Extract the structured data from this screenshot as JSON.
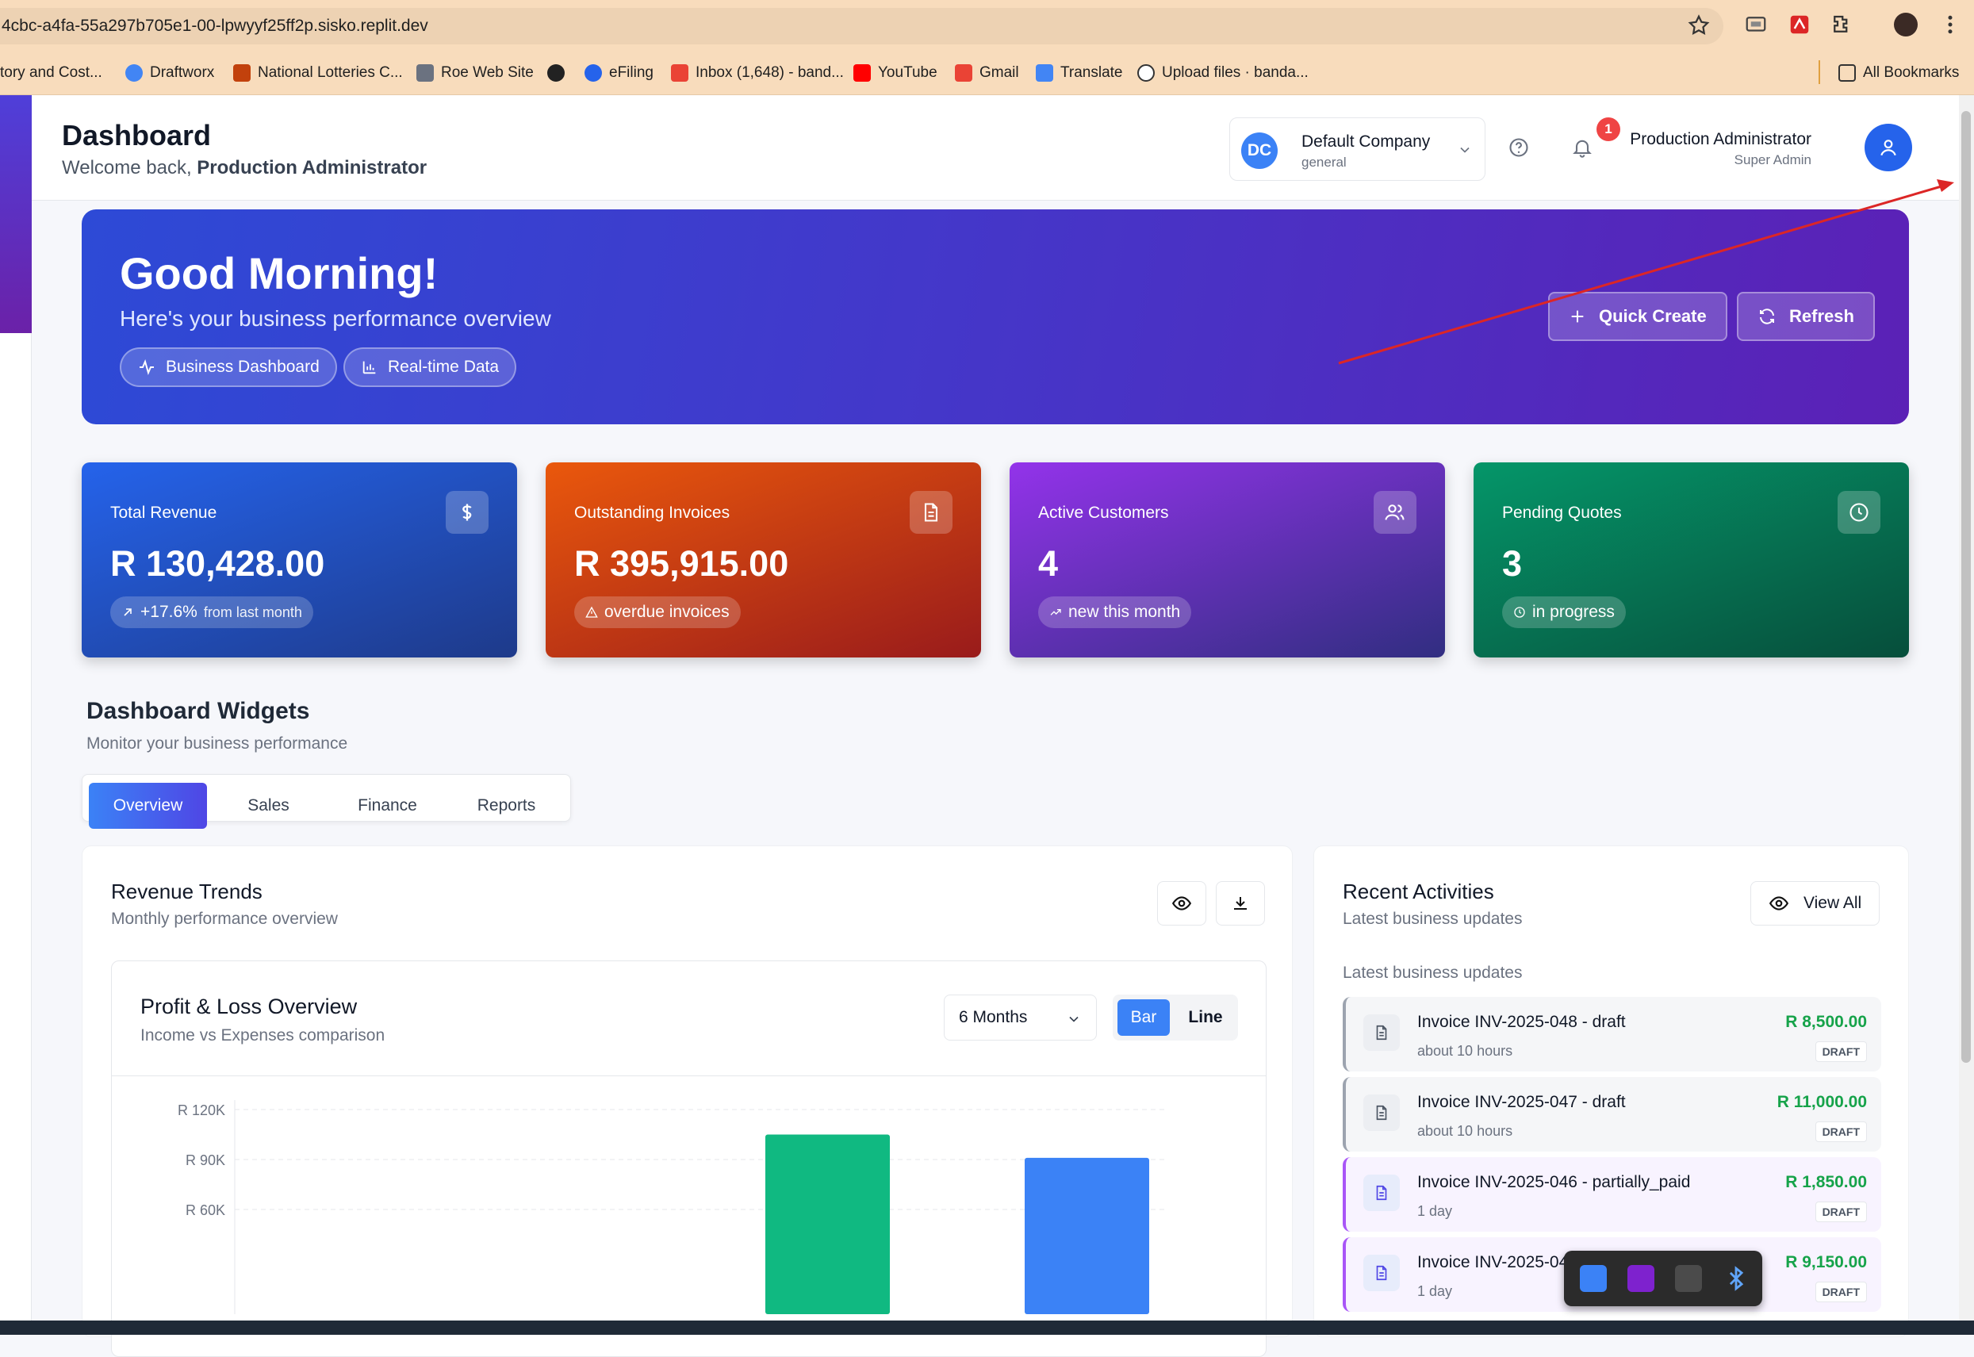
{
  "browser": {
    "url": "4cbc-a4fa-55a297b705e1-00-lpwyyf25ff2p.sisko.replit.dev",
    "bookmarks": [
      "tory and Cost...",
      "Draftworx",
      "National Lotteries C...",
      "Roe Web Site",
      "eFiling",
      "Inbox (1,648) - band...",
      "YouTube",
      "Gmail",
      "Translate",
      "Upload files · banda..."
    ],
    "all_bookmarks": "All Bookmarks"
  },
  "header": {
    "title": "Dashboard",
    "welcome": "Welcome back,",
    "user_name_bold": "Production Administrator",
    "company_initials": "DC",
    "company_name": "Default Company",
    "company_sub": "general",
    "notification_count": "1",
    "user_name": "Production Administrator",
    "user_role": "Super Admin"
  },
  "hero": {
    "greeting": "Good Morning!",
    "subtitle": "Here's your business performance overview",
    "pill_business": "Business Dashboard",
    "pill_realtime": "Real-time Data",
    "quick_create": "Quick Create",
    "refresh": "Refresh"
  },
  "stats": [
    {
      "title": "Total Revenue",
      "value": "R 130,428.00",
      "pill": "+17.6%",
      "pill_note": "from last month",
      "color_from": "#2563eb",
      "color_to": "#1e3a8a"
    },
    {
      "title": "Outstanding Invoices",
      "value": "R 395,915.00",
      "pill": "overdue invoices",
      "color_from": "#ea580c",
      "color_to": "#991b1b"
    },
    {
      "title": "Active Customers",
      "value": "4",
      "pill": "new this month",
      "color_from": "#9333ea",
      "color_to": "#312e81"
    },
    {
      "title": "Pending Quotes",
      "value": "3",
      "pill": "in progress",
      "color_from": "#059669",
      "color_to": "#064e3b"
    }
  ],
  "widgets": {
    "title": "Dashboard Widgets",
    "subtitle": "Monitor your business performance",
    "tabs": [
      "Overview",
      "Sales",
      "Finance",
      "Reports"
    ],
    "active_tab": "Overview"
  },
  "revenue": {
    "title": "Revenue Trends",
    "subtitle": "Monthly performance overview",
    "chart_title": "Profit & Loss Overview",
    "chart_subtitle": "Income vs Expenses comparison",
    "period": "6 Months",
    "toggle_bar": "Bar",
    "toggle_line": "Line"
  },
  "chart_data": {
    "type": "bar",
    "y_ticks": [
      "R 120K",
      "R 90K",
      "R 60K"
    ],
    "y_tick_values": [
      120000,
      90000,
      60000
    ],
    "series": [
      {
        "color": "#10b981",
        "values": [
          105000
        ]
      },
      {
        "color": "#3b82f6",
        "values": [
          91000
        ]
      }
    ]
  },
  "activities": {
    "title": "Recent Activities",
    "subtitle": "Latest business updates",
    "view_all": "View All",
    "list_heading": "Latest business updates",
    "items": [
      {
        "name": "Invoice INV-2025-048 - draft",
        "time": "about 10 hours",
        "amount": "R 8,500.00",
        "status": "DRAFT",
        "accent": "#9ca3af",
        "bg": "#f5f6f8"
      },
      {
        "name": "Invoice INV-2025-047 - draft",
        "time": "about 10 hours",
        "amount": "R 11,000.00",
        "status": "DRAFT",
        "accent": "#9ca3af",
        "bg": "#f5f6f8"
      },
      {
        "name": "Invoice INV-2025-046 - partially_paid",
        "time": "1 day",
        "amount": "R 1,850.00",
        "status": "DRAFT",
        "accent": "#a855f7",
        "bg": "#f8f3ff"
      },
      {
        "name": "Invoice INV-2025-04",
        "time": "1 day",
        "amount": "R 9,150.00",
        "status": "DRAFT",
        "accent": "#a855f7",
        "bg": "#f8f3ff"
      }
    ]
  }
}
